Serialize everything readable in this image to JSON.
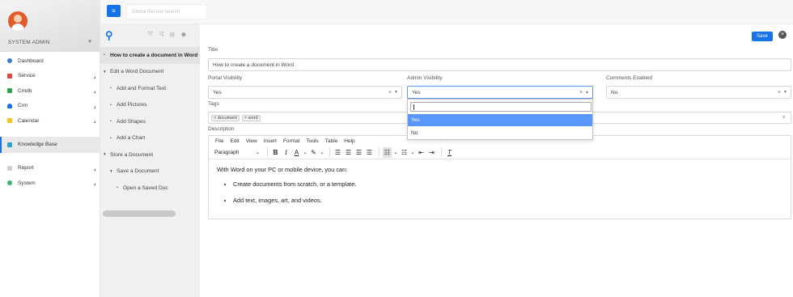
{
  "sidebar": {
    "user": "SYSTEM ADMIN",
    "items": [
      {
        "label": "Dashboard",
        "icon": "dashboard-icon",
        "color": "#3a7bd5"
      },
      {
        "label": "Service",
        "icon": "service-icon",
        "color": "#e0483b"
      },
      {
        "label": "Cmdb",
        "icon": "cmdb-icon",
        "color": "#2ea44f"
      },
      {
        "label": "Crm",
        "icon": "crm-icon",
        "color": "#1572e8"
      },
      {
        "label": "Calendar",
        "icon": "calendar-icon",
        "color": "#f5c518"
      },
      {
        "label": "Knowledge Base",
        "icon": "knowledge-base-icon",
        "color": "#2aa3c7"
      },
      {
        "label": "Report",
        "icon": "report-icon",
        "color": "#c0c0c0"
      },
      {
        "label": "System",
        "icon": "system-icon",
        "color": "#3db56c"
      }
    ]
  },
  "topbar": {
    "search_placeholder": "Global Record Search",
    "menu_icon": "≡"
  },
  "tree": {
    "nodes": [
      {
        "label": "How to create a document in Word",
        "marker": "•",
        "level": 0,
        "selected": true
      },
      {
        "label": "Edit a Word Document",
        "marker": "▾",
        "level": 0
      },
      {
        "label": "Add and Format Text",
        "marker": "•",
        "level": 1
      },
      {
        "label": "Add Pictures",
        "marker": "•",
        "level": 1
      },
      {
        "label": "Add Shapes",
        "marker": "•",
        "level": 1
      },
      {
        "label": "Add a Chart",
        "marker": "•",
        "level": 1
      },
      {
        "label": "Store a Document",
        "marker": "▾",
        "level": 0
      },
      {
        "label": "Save a Document",
        "marker": "▾",
        "level": 1
      },
      {
        "label": "Open a Saved Doc",
        "marker": "•",
        "level": 2
      }
    ]
  },
  "form": {
    "save_label": "Save",
    "title_label": "Title",
    "title_value": "How to create a document in Word",
    "portal_visibility_label": "Portal Visibility",
    "portal_visibility_value": "Yes",
    "admin_visibility_label": "Admin Visibility",
    "admin_visibility_value": "Yes",
    "comments_enabled_label": "Comments Enabled",
    "comments_enabled_value": "No",
    "tags_label": "Tags",
    "tags": [
      "× document",
      "× word"
    ],
    "description_label": "Description"
  },
  "dropdown": {
    "options": [
      {
        "label": "Yes",
        "highlighted": true
      },
      {
        "label": "No",
        "highlighted": false
      }
    ]
  },
  "editor": {
    "menus": [
      "File",
      "Edit",
      "View",
      "Insert",
      "Format",
      "Tools",
      "Table",
      "Help"
    ],
    "block_format": "Paragraph",
    "intro": "With Word on your PC or mobile device, you can:",
    "bullets": [
      "Create documents from scratch, or a template.",
      "Add text, images, art, and videos."
    ]
  },
  "colors": {
    "accent": "#1572e8",
    "highlight": "#5897fb"
  }
}
